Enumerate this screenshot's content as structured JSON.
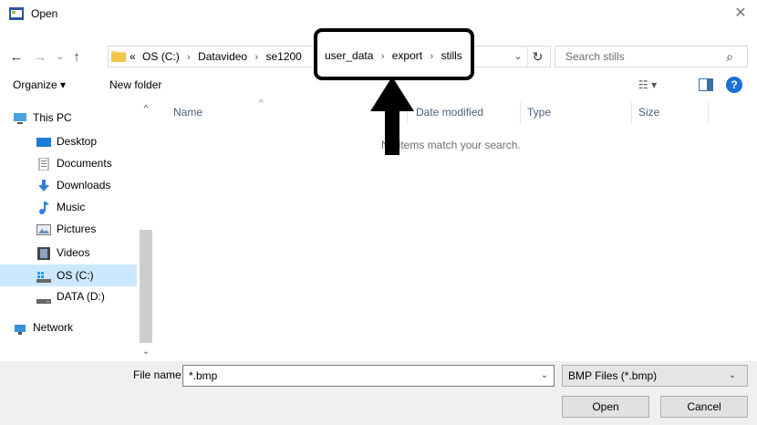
{
  "window": {
    "title": "Open",
    "close_glyph": "✕"
  },
  "nav": {
    "back_glyph": "←",
    "forward_glyph": "→",
    "recent_glyph": "⌄",
    "up_glyph": "↑"
  },
  "address": {
    "crumbs": [
      "«",
      "OS (C:)",
      "Datavideo",
      "se1200"
    ],
    "dropdown_glyph": "⌄",
    "refresh_glyph": "↻"
  },
  "annotation": {
    "crumbs": [
      "user_data",
      "export",
      "stills"
    ]
  },
  "search": {
    "placeholder": "Search stills",
    "icon_glyph": "⌕"
  },
  "toolbar": {
    "organize_label": "Organize ▾",
    "new_folder_label": "New folder",
    "view_label": "☷ ▾",
    "help_label": "?"
  },
  "sidebar": {
    "items": [
      {
        "label": "This PC",
        "icon": "pc-icon"
      },
      {
        "label": "Desktop",
        "icon": "desktop-icon"
      },
      {
        "label": "Documents",
        "icon": "documents-icon"
      },
      {
        "label": "Downloads",
        "icon": "downloads-icon"
      },
      {
        "label": "Music",
        "icon": "music-icon"
      },
      {
        "label": "Pictures",
        "icon": "pictures-icon"
      },
      {
        "label": "Videos",
        "icon": "videos-icon"
      },
      {
        "label": "OS (C:)",
        "icon": "drive-c-icon",
        "selected": true
      },
      {
        "label": "DATA (D:)",
        "icon": "drive-d-icon"
      },
      {
        "label": "Network",
        "icon": "network-icon"
      }
    ],
    "scroll_up_glyph": "^",
    "scroll_down_glyph": "⌄"
  },
  "columns": {
    "name": "Name",
    "date": "Date modified",
    "type": "Type",
    "size": "Size",
    "sort_glyph": "^"
  },
  "content": {
    "empty_message": "No items match your search."
  },
  "bottom": {
    "filename_label": "File name:",
    "filename_value": "*.bmp",
    "filetype_value": "BMP Files (*.bmp)",
    "open_label": "Open",
    "cancel_label": "Cancel",
    "chevron_glyph": "⌄"
  },
  "colors": {
    "selection": "#cce8ff",
    "help": "#1a6fd4",
    "folder": "#f8d775"
  }
}
